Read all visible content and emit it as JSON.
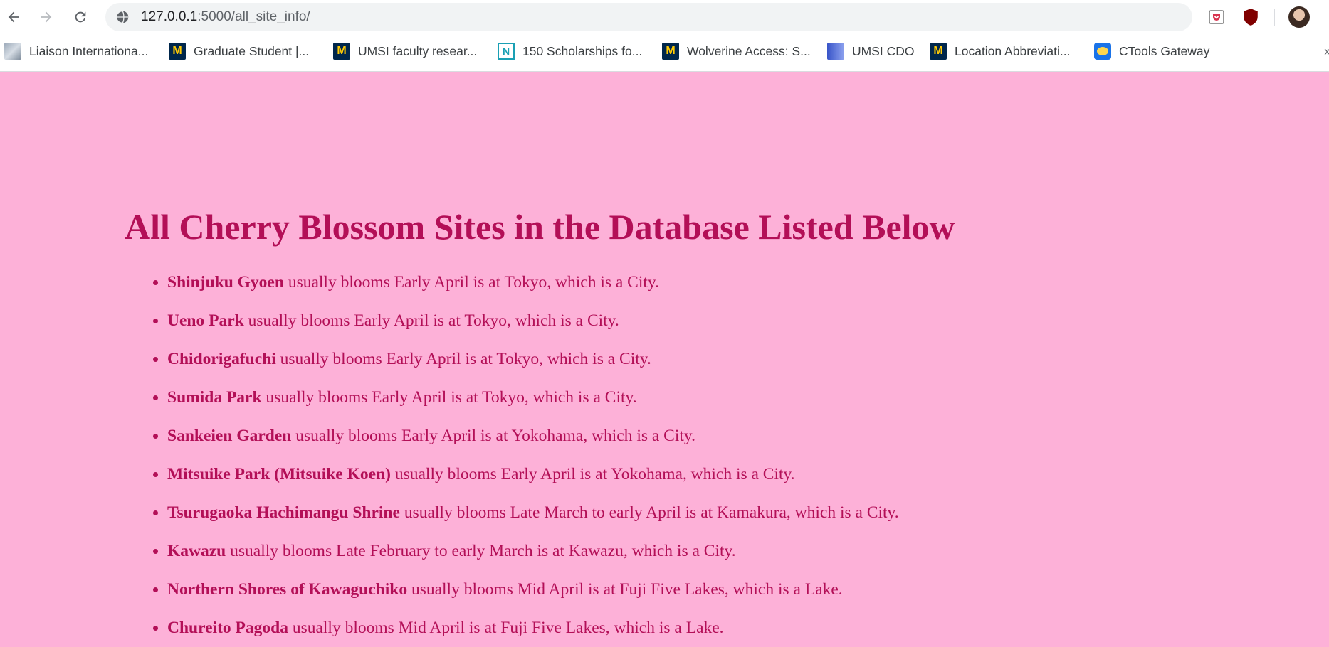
{
  "browser": {
    "url_host": "127.0.0.1",
    "url_path": ":5000/all_site_info/",
    "bookmarks": [
      {
        "label": "Liaison Internationa...",
        "icon": "map-favicon-icon"
      },
      {
        "label": "Graduate Student |...",
        "icon": "umich-m-icon"
      },
      {
        "label": "UMSI faculty resear...",
        "icon": "umich-m-icon"
      },
      {
        "label": "150 Scholarships fo...",
        "icon": "n-favicon-icon"
      },
      {
        "label": "Wolverine Access: S...",
        "icon": "umich-m-icon"
      },
      {
        "label": "UMSI CDO",
        "icon": "cdo-favicon-icon"
      },
      {
        "label": "Location Abbreviati...",
        "icon": "umich-m-icon"
      },
      {
        "label": "CTools Gateway",
        "icon": "ctools-favicon-icon"
      }
    ],
    "m_glyph": "M",
    "n_glyph": "N",
    "overflow_glyph": "»"
  },
  "colors": {
    "page_background": "#fdb1d8",
    "text": "#b30f57"
  },
  "page": {
    "heading": "All Cherry Blossom Sites in the Database Listed Below",
    "sites": [
      {
        "name": "Shinjuku Gyoen",
        "detail": "usually blooms Early April is at Tokyo, which is a City."
      },
      {
        "name": "Ueno Park",
        "detail": "usually blooms Early April is at Tokyo, which is a City."
      },
      {
        "name": "Chidorigafuchi",
        "detail": "usually blooms Early April is at Tokyo, which is a City."
      },
      {
        "name": "Sumida Park",
        "detail": "usually blooms Early April is at Tokyo, which is a City."
      },
      {
        "name": "Sankeien Garden",
        "detail": "usually blooms Early April is at Yokohama, which is a City."
      },
      {
        "name": "Mitsuike Park (Mitsuike Koen)",
        "detail": "usually blooms Early April is at Yokohama, which is a City."
      },
      {
        "name": "Tsurugaoka Hachimangu Shrine",
        "detail": "usually blooms Late March to early April is at Kamakura, which is a City."
      },
      {
        "name": "Kawazu",
        "detail": "usually blooms Late February to early March is at Kawazu, which is a City."
      },
      {
        "name": "Northern Shores of Kawaguchiko",
        "detail": "usually blooms Mid April is at Fuji Five Lakes, which is a Lake."
      },
      {
        "name": "Chureito Pagoda",
        "detail": "usually blooms Mid April is at Fuji Five Lakes, which is a Lake."
      }
    ]
  }
}
